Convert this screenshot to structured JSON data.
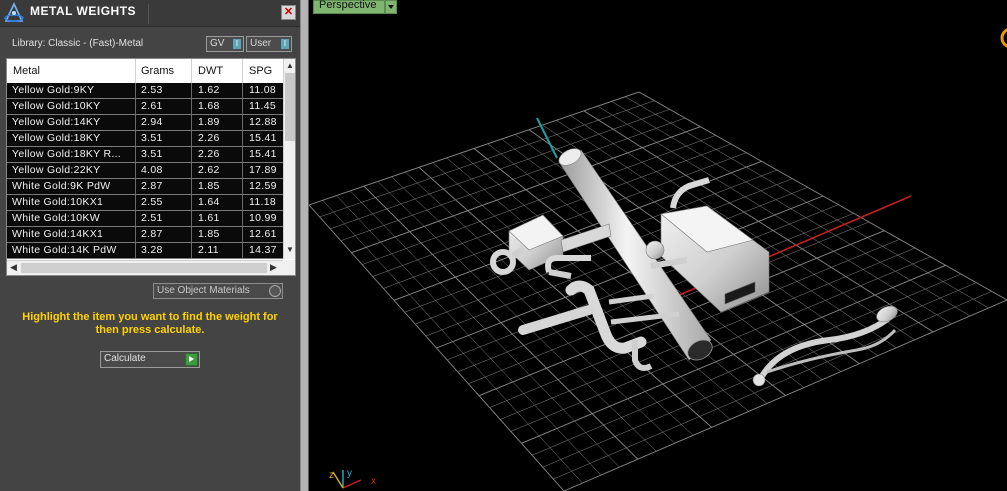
{
  "panel": {
    "title": "METAL WEIGHTS",
    "close_glyph": "✕",
    "library_label": "Library: Classic - (Fast)-Metal",
    "toggles": [
      {
        "label": "GV",
        "glyph": "I"
      },
      {
        "label": "User",
        "glyph": "I"
      }
    ],
    "table": {
      "columns": [
        "Metal",
        "Grams",
        "DWT",
        "SPG"
      ],
      "rows": [
        [
          "Yellow Gold:9KY",
          "2.53",
          "1.62",
          "11.08"
        ],
        [
          "Yellow Gold:10KY",
          "2.61",
          "1.68",
          "11.45"
        ],
        [
          "Yellow Gold:14KY",
          "2.94",
          "1.89",
          "12.88"
        ],
        [
          "Yellow Gold:18KY",
          "3.51",
          "2.26",
          "15.41"
        ],
        [
          "Yellow Gold:18KY R...",
          "3.51",
          "2.26",
          "15.41"
        ],
        [
          "Yellow Gold:22KY",
          "4.08",
          "2.62",
          "17.89"
        ],
        [
          "White Gold:9K PdW",
          "2.87",
          "1.85",
          "12.59"
        ],
        [
          "White Gold:10KX1",
          "2.55",
          "1.64",
          "11.18"
        ],
        [
          "White Gold:10KW",
          "2.51",
          "1.61",
          "10.99"
        ],
        [
          "White Gold:14KX1",
          "2.87",
          "1.85",
          "12.61"
        ],
        [
          "White Gold:14K PdW",
          "3.28",
          "2.11",
          "14.37"
        ]
      ]
    },
    "object_materials_label": "Use Object Materials",
    "hint": "Highlight the item you want to find the weight for then press calculate.",
    "calculate_label": "Calculate"
  },
  "viewport": {
    "view_name": "Perspective",
    "axis_labels": {
      "x": "x",
      "y": "y",
      "z": "z"
    }
  },
  "colors": {
    "panel_bg": "#444444",
    "hint_text": "#ffd200",
    "grid_line": "#8a8a8a",
    "x_axis": "#c42020",
    "y_axis": "#1fa3a3",
    "perspective_tab": "#7fb56e"
  }
}
